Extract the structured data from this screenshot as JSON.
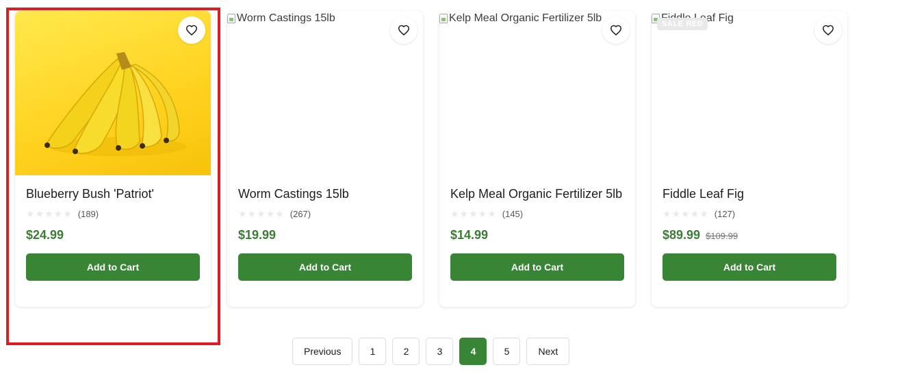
{
  "products": [
    {
      "title": "Blueberry Bush 'Patriot'",
      "image_alt": "",
      "rating_stars": "★★★★★",
      "review_count": "(189)",
      "price": "$24.99",
      "old_price": "",
      "add_to_cart": "Add to Cart",
      "favorite_icon": "heart-outline-icon"
    },
    {
      "title": "Worm Castings 15lb",
      "image_alt": "Worm Castings 15lb",
      "rating_stars": "★★★★★",
      "review_count": "(267)",
      "price": "$19.99",
      "old_price": "",
      "add_to_cart": "Add to Cart",
      "favorite_icon": "heart-outline-icon"
    },
    {
      "title": "Kelp Meal Organic Fertilizer 5lb",
      "image_alt": "Kelp Meal Organic Fertilizer 5lb",
      "rating_stars": "★★★★★",
      "review_count": "(145)",
      "price": "$14.99",
      "old_price": "",
      "add_to_cart": "Add to Cart",
      "favorite_icon": "heart-outline-icon"
    },
    {
      "title": "Fiddle Leaf Fig",
      "image_alt": "Fiddle Leaf Fig",
      "badge": "SALE  RED",
      "rating_stars": "★★★★★",
      "review_count": "(127)",
      "price": "$89.99",
      "old_price": "$109.99",
      "add_to_cart": "Add to Cart",
      "favorite_icon": "heart-outline-icon"
    }
  ],
  "pagination": {
    "previous": "Previous",
    "pages": [
      "1",
      "2",
      "3",
      "4",
      "5"
    ],
    "current": "4",
    "next": "Next"
  },
  "colors": {
    "brand_green": "#388535",
    "price_green": "#3a7d34",
    "highlight_red": "#e01b22"
  }
}
